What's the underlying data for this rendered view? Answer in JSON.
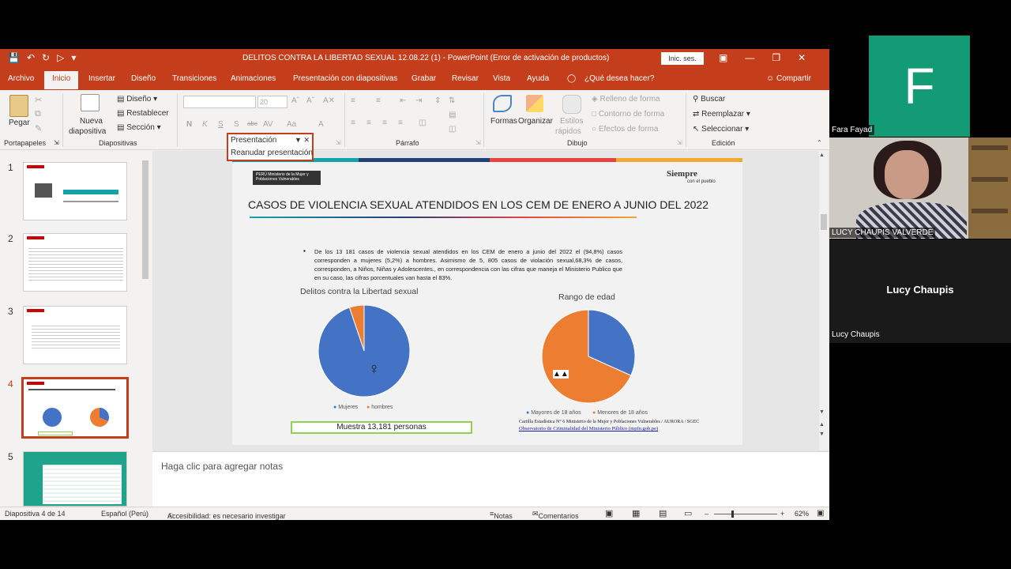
{
  "window": {
    "title": "DELITOS CONTRA LA LIBERTAD SEXUAL  12.08.22 (1)  -  PowerPoint (Error de activación de productos)",
    "sign_in": "Inic. ses."
  },
  "tabs": [
    "Archivo",
    "Inicio",
    "Insertar",
    "Diseño",
    "Transiciones",
    "Animaciones",
    "Presentación con diapositivas",
    "Grabar",
    "Revisar",
    "Vista",
    "Ayuda"
  ],
  "tell_me": "¿Qué desea hacer?",
  "share": "Compartir",
  "ribbon": {
    "paste": "Pegar",
    "new_slide_1": "Nueva",
    "new_slide_2": "diapositiva",
    "layout": "Diseño",
    "reset": "Restablecer",
    "section": "Sección",
    "font_size": "20",
    "shapes": "Formas",
    "arrange": "Organizar",
    "styles_1": "Estilos",
    "styles_2": "rápidos",
    "fill": "Relleno de forma",
    "outline": "Contorno de forma",
    "effects": "Efectos de forma",
    "find": "Buscar",
    "replace": "Reemplazar",
    "select": "Seleccionar",
    "groups": {
      "clipboard": "Portapapeles",
      "slides": "Diapositivas",
      "paragraph": "Párrafo",
      "drawing": "Dibujo",
      "editing": "Edición"
    }
  },
  "popup": {
    "title": "Presentación",
    "item": "Reanudar presentación"
  },
  "thumbnails": [
    "1",
    "2",
    "3",
    "4",
    "5"
  ],
  "slide": {
    "title": "CASOS DE VIOLENCIA SEXUAL ATENDIDOS EN LOS CEM DE ENERO A JUNIO DEL 2022",
    "logo_left": "PERÚ  Ministerio de la Mujer y Poblaciones Vulnerables",
    "logo_right_1": "Siempre",
    "logo_right_2": "con el pueblo",
    "bullet": "De los 13 181 casos de violencia sexual atendidos en los CEM de enero a junio del 2022 el  (94,8%) casos corresponden a mujeres (5,2%) a hombres. Asimismo de  5, 805 casos de violación sexual,68,3% de casos, corresponden, a Niños, Niñas y Adolescentes., en correspondencia con las cifras que maneja el Ministerio Publico que en su caso,  las cifras porcentuales van hasta el 83%.",
    "muestra": "Muestra 13,181 personas",
    "source_1": "Cartilla Estadística N° 6 Ministerio de la Mujer y Poblaciones Vulnerables / AURORA / SGEC",
    "source_2": "Observatorio de Criminalidad del Ministerio Público (mpfn.gob.pe)"
  },
  "chart_data": [
    {
      "type": "pie",
      "title": "Delitos contra la Libertad sexual",
      "categories": [
        "Mujeres",
        "hombres"
      ],
      "values": [
        94.8,
        5.2
      ],
      "colors": [
        "#4472c4",
        "#ed7d31"
      ],
      "legend": "bottom"
    },
    {
      "type": "pie",
      "title": "Rango de edad",
      "categories": [
        "Mayores de 18 años",
        "Menores de 18 años"
      ],
      "values": [
        31.7,
        68.3
      ],
      "colors": [
        "#4472c4",
        "#ed7d31"
      ],
      "legend": "bottom"
    }
  ],
  "notes_placeholder": "Haga clic para agregar notas",
  "status": {
    "slide": "Diapositiva 4 de 14",
    "lang": "Español (Perú)",
    "a11y": "Accesibilidad: es necesario investigar",
    "notes": "Notas",
    "comments": "Comentarios",
    "zoom": "62%"
  },
  "participants": {
    "p1_initial": "F",
    "p1_name": "Fara Fayad",
    "p2_label": "LUCY CHAUPIS VALVERDE",
    "p3_big": "Lucy Chaupis",
    "p3_name": "Lucy Chaupis"
  },
  "colors": {
    "accent": "#c43e1c",
    "teal": "#139b76"
  }
}
